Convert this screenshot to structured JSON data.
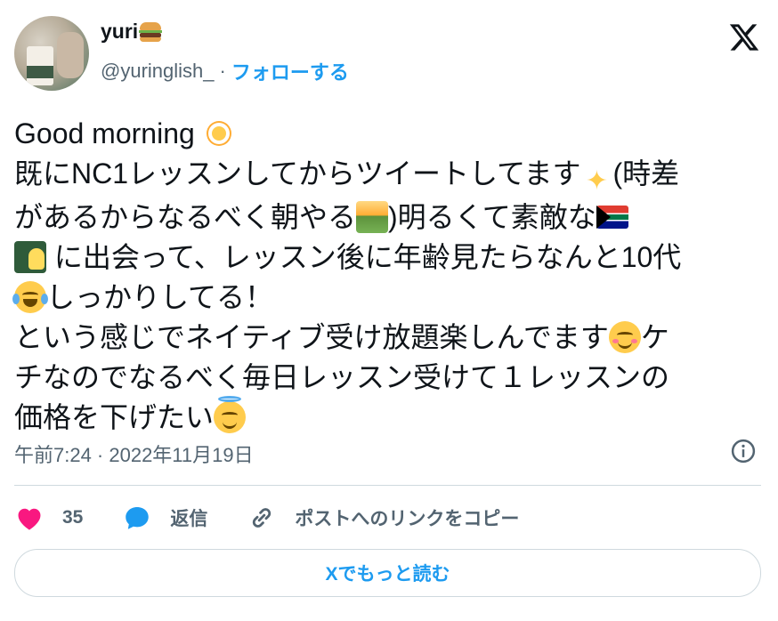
{
  "author": {
    "display_name": "yuri",
    "name_emoji": "hamburger-emoji",
    "handle": "@yuringlish_",
    "separator": "·",
    "follow_label": "フォローする"
  },
  "tweet": {
    "lines": [
      {
        "parts": [
          "Good morning ",
          "{sun}"
        ]
      },
      {
        "parts": [
          "既にNC1レッスンしてからツイートしてます",
          "{sparkles}",
          "(時差"
        ]
      },
      {
        "parts": [
          "があるからなるべく朝やる",
          "{sunrise}",
          ")明るくて素敵な",
          "{flag-za}"
        ]
      },
      {
        "parts": [
          "{teacher}",
          " に出会って、レッスン後に年齢見たらなんと10代"
        ]
      },
      {
        "parts": [
          "{joy}",
          "しっかりしてる！"
        ]
      },
      {
        "parts": [
          "という感じでネイティブ受け放題楽しんでます",
          "{blush}",
          "ケ"
        ]
      },
      {
        "parts": [
          "チなのでなるべく毎日レッスン受けて１レッスンの"
        ]
      },
      {
        "parts": [
          "価格を下げたい",
          "{halo}"
        ]
      }
    ],
    "text_segments": {
      "l1": "Good morning ",
      "l2": "既にNC1レッスンしてからツイートしてます",
      "l2b": "(時差",
      "l3": "があるからなるべく朝やる",
      "l3b": ")明るくて素敵な",
      "l4": " に出会って、レッスン後に年齢見たらなんと10代",
      "l5": "しっかりしてる！",
      "l6": "という感じでネイティブ受け放題楽しんでます",
      "l6b": "ケ",
      "l7": "チなのでなるべく毎日レッスン受けて１レッスンの",
      "l8": "価格を下げたい"
    },
    "timestamp": "午前7:24 · 2022年11月19日"
  },
  "actions": {
    "like_count": "35",
    "reply_label": "返信",
    "copy_link_label": "ポストへのリンクをコピー"
  },
  "read_more_label": "Xでもっと読む",
  "colors": {
    "accent": "#1d9bf0",
    "like": "#f91880",
    "secondary_text": "#536471",
    "border": "#cfd9de"
  }
}
